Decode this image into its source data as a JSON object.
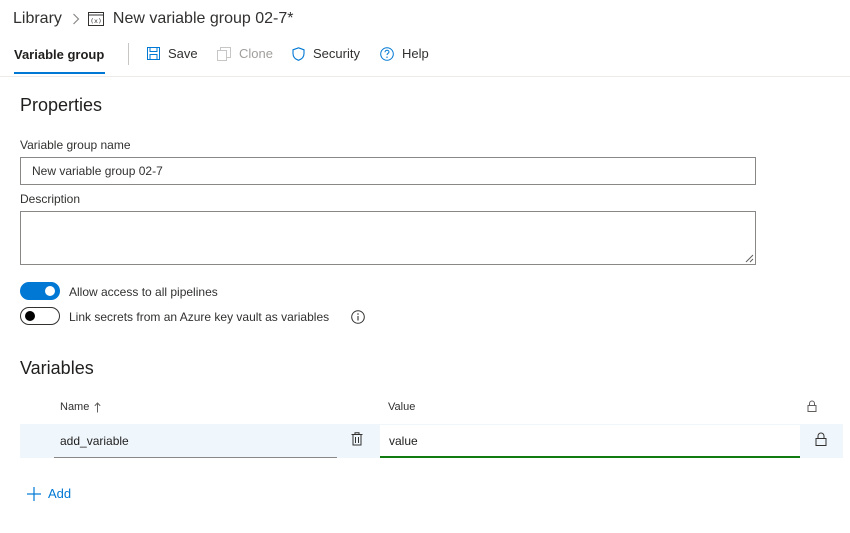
{
  "breadcrumb": {
    "root": "Library",
    "separator": ">",
    "current": "New variable group 02-7*",
    "current_icon": "variable-group-icon"
  },
  "toolbar": {
    "active_tab": "Variable group",
    "save_label": "Save",
    "clone_label": "Clone",
    "security_label": "Security",
    "help_label": "Help"
  },
  "properties": {
    "title": "Properties",
    "name_label": "Variable group name",
    "name_value": "New variable group 02-7",
    "description_label": "Description",
    "description_value": ""
  },
  "toggles": {
    "allow_access_label": "Allow access to all pipelines",
    "allow_access_on": true,
    "link_secrets_label": "Link secrets from an Azure key vault as variables",
    "link_secrets_on": false
  },
  "variables": {
    "title": "Variables",
    "columns": {
      "name": "Name",
      "value": "Value",
      "sort": "ascending"
    },
    "rows": [
      {
        "name": "add_variable",
        "value": "value",
        "secret": false
      }
    ],
    "add_label": "Add"
  },
  "colors": {
    "accent": "#0078d4",
    "row_highlight": "#eff6fc",
    "value_underline": "#107c10"
  }
}
